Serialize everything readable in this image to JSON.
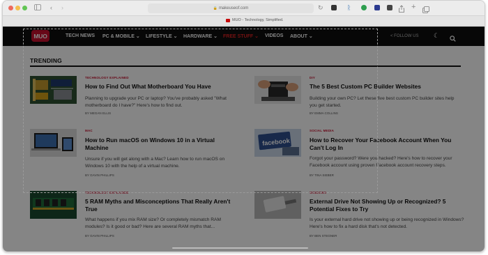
{
  "browser": {
    "url": "makeuseof.com",
    "tab_title": "MUO - Technology, Simplified."
  },
  "site": {
    "logo_text": "MUO",
    "nav": [
      {
        "label": "TECH NEWS"
      },
      {
        "label": "PC & MOBILE ⌄"
      },
      {
        "label": "LIFESTYLE ⌄"
      },
      {
        "label": "HARDWARE ⌄"
      },
      {
        "label": "FREE STUFF ⌄"
      },
      {
        "label": "VIDEOS"
      },
      {
        "label": "ABOUT ⌄"
      }
    ],
    "follow_label": "FOLLOW US",
    "colors": {
      "brand": "#c8102e",
      "nav_bg": "#0f0f0f",
      "highlight": "#e02424"
    },
    "icons": [
      "share-icon",
      "moon-icon",
      "search-icon"
    ]
  },
  "trending": {
    "heading": "TRENDING",
    "articles": [
      {
        "category": "TECHNOLOGY EXPLAINED",
        "title": "How to Find Out What Motherboard You Have",
        "description": "Planning to upgrade your PC or laptop? You've probably asked \"What motherboard do I have?\" Here's how to find out.",
        "byline": "BY MEGAN ELLIS"
      },
      {
        "category": "DIY",
        "title": "The 5 Best Custom PC Builder Websites",
        "description": "Building your own PC? Let these five best custom PC builder sites help you get started.",
        "byline": "BY EMMA COLLINS"
      },
      {
        "category": "MAC",
        "title": "How to Run macOS on Windows 10 in a Virtual Machine",
        "description": "Unsure if you will get along with a Mac? Learn how to run macOS on Windows 10 with the help of a virtual machine.",
        "byline": "BY GAVIN PHILLIPS"
      },
      {
        "category": "SOCIAL MEDIA",
        "title": "How to Recover Your Facebook Account When You Can't Log In",
        "description": "Forgot your password? Were you hacked? Here's how to recover your Facebook account using proven Facebook account recovery steps.",
        "byline": "BY TINA SIEBER"
      },
      {
        "category": "TECHNOLOGY EXPLAINED",
        "title": "5 RAM Myths and Misconceptions That Really Aren't True",
        "description": "What happens if you mix RAM size? Or completely mismatch RAM modules? Is it good or bad? Here are several RAM myths that...",
        "byline": "BY GAVIN PHILLIPS"
      },
      {
        "category": "WINDOWS",
        "title": "External Drive Not Showing Up or Recognized? 5 Potential Fixes to Try",
        "description": "Is your external hard drive not showing up or being recognized in Windows? Here's how to fix a hard disk that's not detected.",
        "byline": "BY BEN STEGNER"
      }
    ]
  }
}
